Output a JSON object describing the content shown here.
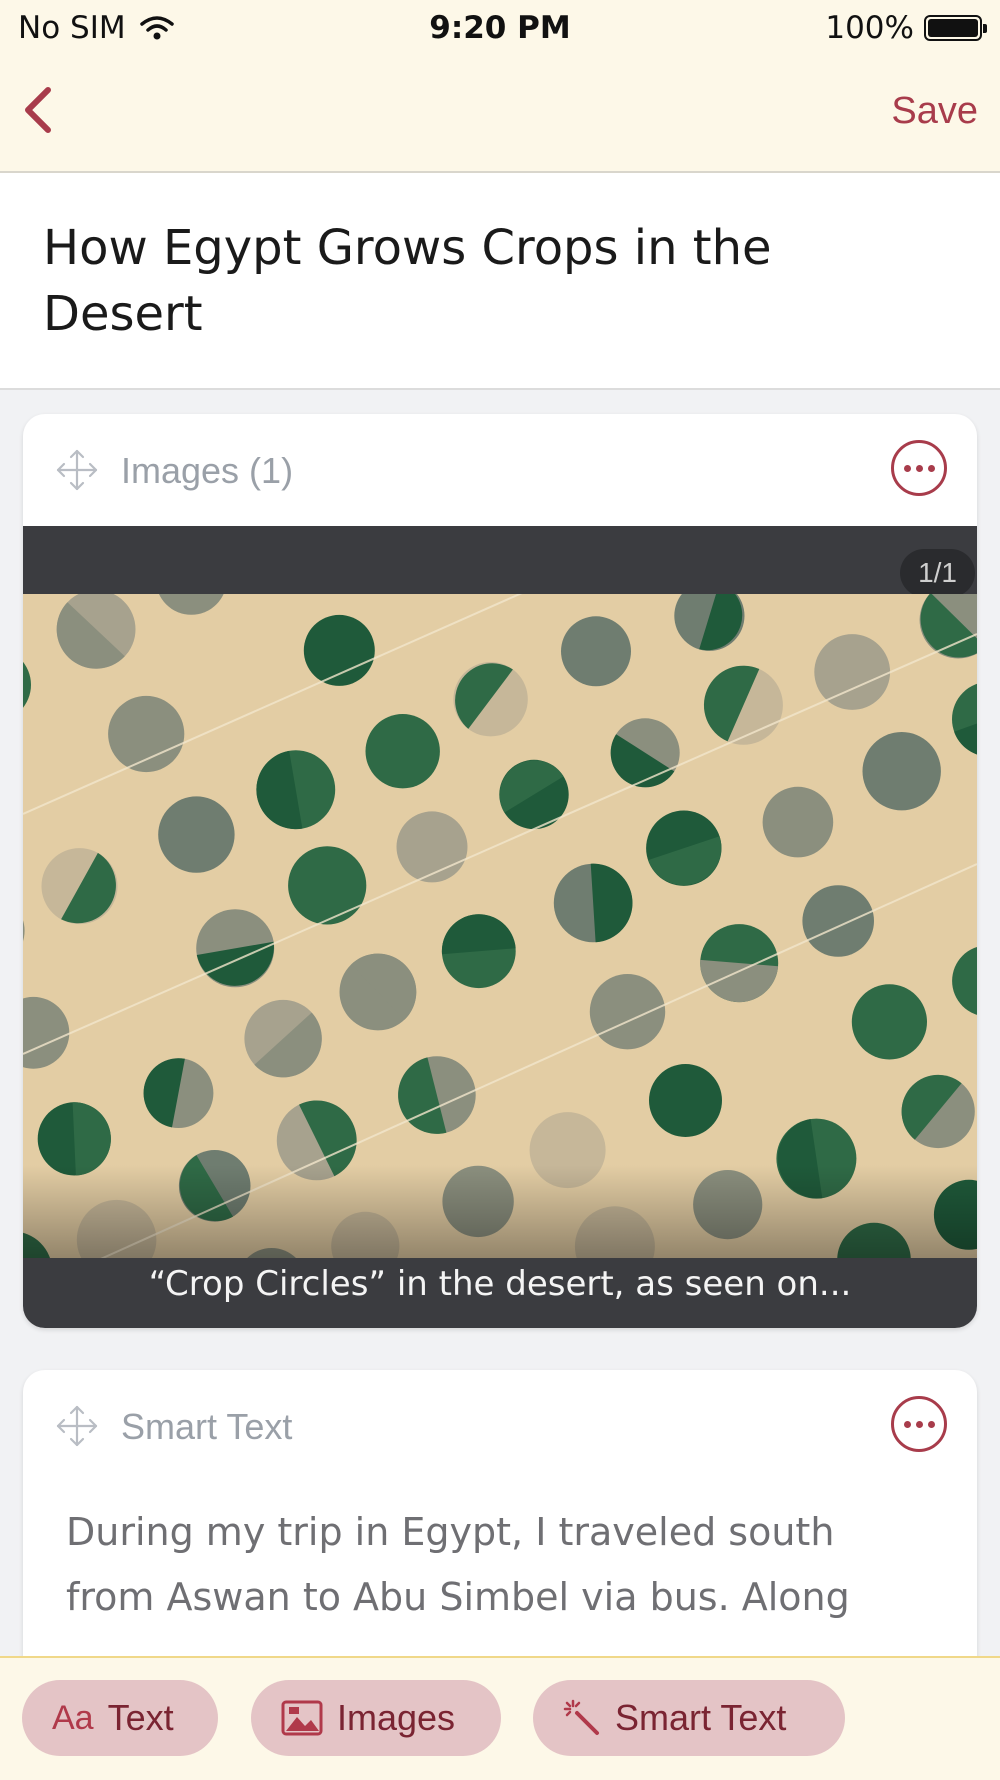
{
  "status_bar": {
    "carrier": "No SIM",
    "time": "9:20 PM",
    "battery": "100%"
  },
  "nav": {
    "save_label": "Save"
  },
  "story": {
    "title": "How Egypt Grows Crops in the Desert"
  },
  "images_block": {
    "label": "Images (1)",
    "counter": "1/1",
    "caption": "“Crop Circles” in the desert, as seen on..."
  },
  "smart_text_block": {
    "label": "Smart Text",
    "body": "During my trip in Egypt, I traveled south from Aswan to Abu Simbel via bus. Along"
  },
  "toolbar": {
    "text_label": "Text",
    "text_icon": "Aa",
    "images_label": "Images",
    "smart_text_label": "Smart Text"
  },
  "colors": {
    "accent": "#a83c4b",
    "bar_bg": "#fdf8e8",
    "pill_bg": "#e4c4c6"
  }
}
